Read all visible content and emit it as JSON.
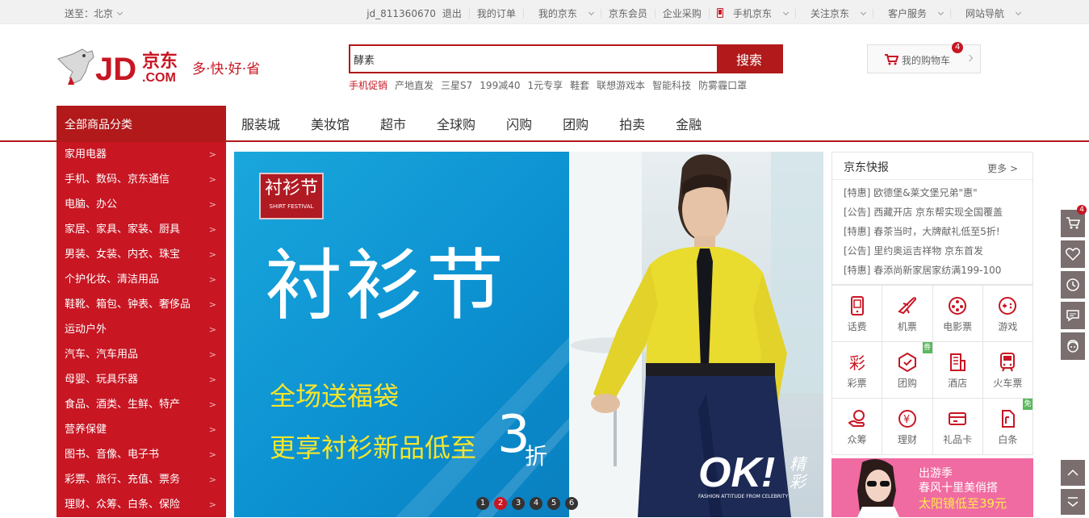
{
  "topbar": {
    "location_label": "送至：北京",
    "user": "jd_811360670",
    "logout": "退出",
    "links": [
      "我的订单",
      "我的京东",
      "京东会员",
      "企业采购",
      "手机京东",
      "关注京东",
      "客户服务",
      "网站导航"
    ]
  },
  "logo": {
    "text": "JD.COM 京东",
    "slogan": "多·快·好·省"
  },
  "search": {
    "value": "酵素",
    "button": "搜索"
  },
  "hotwords": [
    "手机促销",
    "产地直发",
    "三星S7",
    "199减40",
    "1元专享",
    "鞋套",
    "联想游戏本",
    "智能科技",
    "防雾霾口罩"
  ],
  "cart": {
    "label": "我的购物车",
    "count": "4"
  },
  "nav": {
    "all_categories": "全部商品分类",
    "items": [
      "服装城",
      "美妆馆",
      "超市",
      "全球购",
      "闪购",
      "团购",
      "拍卖",
      "金融"
    ]
  },
  "categories": [
    "家用电器",
    "手机、数码、京东通信",
    "电脑、办公",
    "家居、家具、家装、厨具",
    "男装、女装、内衣、珠宝",
    "个护化妆、清洁用品",
    "鞋靴、箱包、钟表、奢侈品",
    "运动户外",
    "汽车、汽车用品",
    "母婴、玩具乐器",
    "食品、酒类、生鲜、特产",
    "营养保健",
    "图书、音像、电子书",
    "彩票、旅行、充值、票务",
    "理财、众筹、白条、保险"
  ],
  "banner": {
    "badge_cn": "衬衫节",
    "badge_en": "SHIRT FESTIVAL",
    "headline": "衬衫节",
    "line1": "全场送福袋",
    "line2": "更享衬衫新品低至",
    "discount_num": "3",
    "discount_unit": "折",
    "ok_text": "OK!",
    "ok_sub": "精彩",
    "ok_tag": "FASHION ATTITUDE FROM CELEBRITY",
    "dots": [
      "1",
      "2",
      "3",
      "4",
      "5",
      "6"
    ]
  },
  "news": {
    "title": "京东快报",
    "more": "更多",
    "items": [
      {
        "tag": "[特惠]",
        "text": "欧德堡&莱文堡兄弟\"惠\""
      },
      {
        "tag": "[公告]",
        "text": "西藏开店 京东帮实现全国覆盖"
      },
      {
        "tag": "[特惠]",
        "text": "春茶当时，大牌献礼低至5折!"
      },
      {
        "tag": "[公告]",
        "text": "里约奥运吉祥物 京东首发"
      },
      {
        "tag": "[特惠]",
        "text": "春添尚新家居家纺满199-100"
      }
    ]
  },
  "services": [
    {
      "label": "话费",
      "icon": "phone-icon",
      "tag": ""
    },
    {
      "label": "机票",
      "icon": "plane-icon",
      "tag": ""
    },
    {
      "label": "电影票",
      "icon": "film-icon",
      "tag": ""
    },
    {
      "label": "游戏",
      "icon": "gamepad-icon",
      "tag": ""
    },
    {
      "label": "彩票",
      "icon": "lottery-icon",
      "tag": ""
    },
    {
      "label": "团购",
      "icon": "groupbuy-icon",
      "tag": "劵"
    },
    {
      "label": "酒店",
      "icon": "hotel-icon",
      "tag": ""
    },
    {
      "label": "火车票",
      "icon": "train-icon",
      "tag": ""
    },
    {
      "label": "众筹",
      "icon": "crowdfund-icon",
      "tag": ""
    },
    {
      "label": "理财",
      "icon": "finance-icon",
      "tag": ""
    },
    {
      "label": "礼品卡",
      "icon": "giftcard-icon",
      "tag": ""
    },
    {
      "label": "白条",
      "icon": "baitiao-icon",
      "tag": "免"
    }
  ],
  "promo": {
    "line1": "出游季",
    "line2": "春风十里美俏搭",
    "line3": "太阳镜低至39元"
  },
  "sidetools": {
    "cart_count": "4"
  },
  "colors": {
    "brand_red": "#c81623",
    "dark_red": "#b1191a"
  }
}
